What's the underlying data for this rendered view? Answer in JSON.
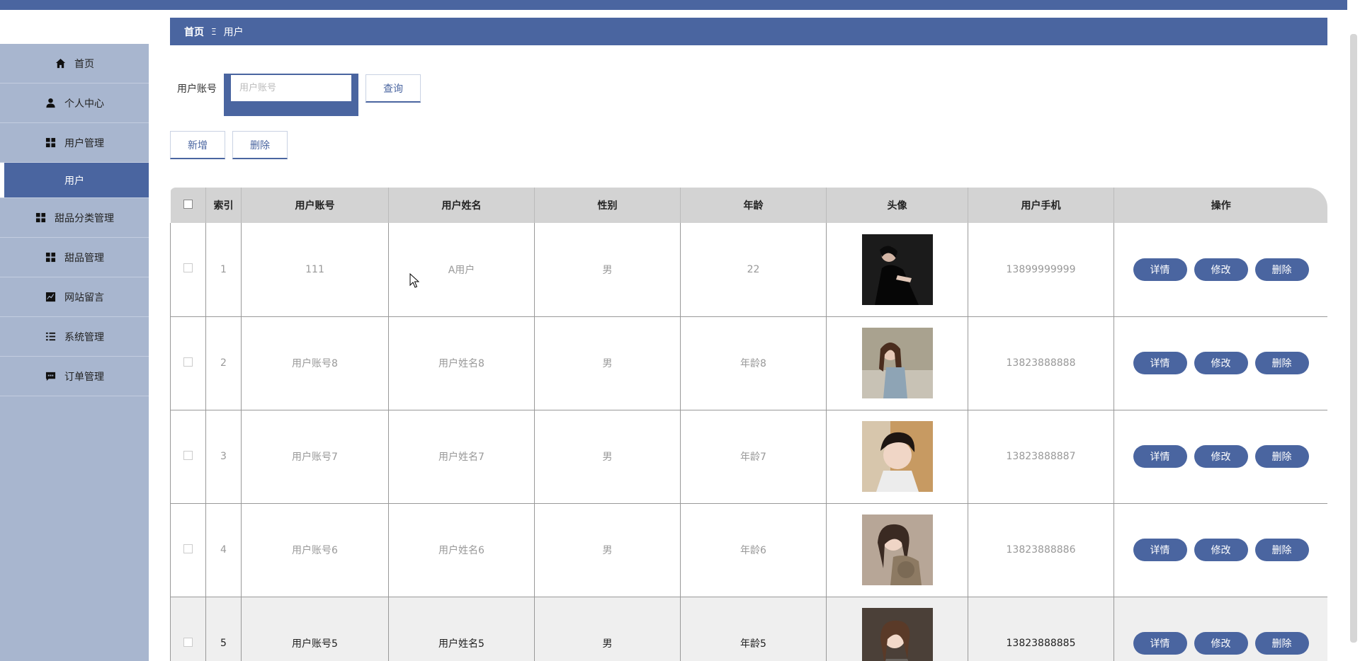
{
  "sidebar": {
    "items": [
      {
        "label": "首页",
        "icon": "home-icon"
      },
      {
        "label": "个人中心",
        "icon": "user-icon"
      },
      {
        "label": "用户管理",
        "icon": "grid-icon"
      },
      {
        "label": "用户",
        "icon": ""
      },
      {
        "label": "甜品分类管理",
        "icon": "grid-icon"
      },
      {
        "label": "甜品管理",
        "icon": "grid-icon"
      },
      {
        "label": "网站留言",
        "icon": "chart-icon"
      },
      {
        "label": "系统管理",
        "icon": "list-icon"
      },
      {
        "label": "订单管理",
        "icon": "message-icon"
      }
    ]
  },
  "breadcrumb": {
    "home": "首页",
    "separator": "Ξ",
    "current": "用户"
  },
  "search": {
    "label": "用户账号",
    "placeholder": "用户账号",
    "value": "",
    "button": "查询"
  },
  "toolbar": {
    "add": "新增",
    "delete": "删除"
  },
  "table": {
    "headers": [
      "",
      "索引",
      "用户账号",
      "用户姓名",
      "性别",
      "年龄",
      "头像",
      "用户手机",
      "操作"
    ],
    "rows": [
      {
        "index": "1",
        "account": "111",
        "name": "A用户",
        "gender": "男",
        "age": "22",
        "phone": "13899999999"
      },
      {
        "index": "2",
        "account": "用户账号8",
        "name": "用户姓名8",
        "gender": "男",
        "age": "年龄8",
        "phone": "13823888888"
      },
      {
        "index": "3",
        "account": "用户账号7",
        "name": "用户姓名7",
        "gender": "男",
        "age": "年龄7",
        "phone": "13823888887"
      },
      {
        "index": "4",
        "account": "用户账号6",
        "name": "用户姓名6",
        "gender": "男",
        "age": "年龄6",
        "phone": "13823888886"
      },
      {
        "index": "5",
        "account": "用户账号5",
        "name": "用户姓名5",
        "gender": "男",
        "age": "年龄5",
        "phone": "13823888885"
      }
    ],
    "actions": {
      "detail": "详情",
      "edit": "修改",
      "remove": "删除"
    }
  },
  "colors": {
    "primary": "#4a65a0",
    "sidebar_bg": "#a8b6cf",
    "header_bg": "#d3d3d3"
  }
}
